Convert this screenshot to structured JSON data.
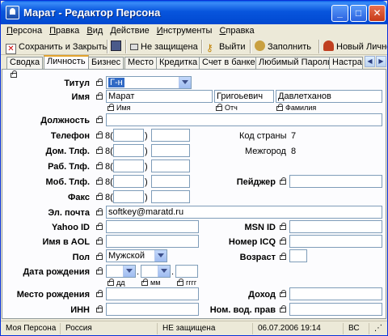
{
  "window": {
    "title": "Марат - Редактор Персона"
  },
  "menu": [
    "Персона",
    "Правка",
    "Вид",
    "Действие",
    "Инструменты",
    "Справка"
  ],
  "toolbar": {
    "save_close": "Сохранить и Закрыть",
    "not_protected": "Не защищена",
    "exit": "Выйти",
    "fill": "Заполнить",
    "new_person": "Новый Личность"
  },
  "tabs": [
    "Сводка",
    "Личность",
    "Бизнес",
    "Место",
    "Кредитка",
    "Счет в банке",
    "Любимый Пароль",
    "Настра"
  ],
  "form": {
    "title_label": "Титул",
    "title_value": "Г-н",
    "name_label": "Имя",
    "first_name": "Марат",
    "patronymic": "Григоьевич",
    "last_name": "Давлетханов",
    "sub_first": "Имя",
    "sub_patronymic": "Отч",
    "sub_last": "Фамилия",
    "position_label": "Должность",
    "phone_label": "Телефон",
    "home_phone_label": "Дом. Тлф.",
    "work_phone_label": "Раб. Тлф.",
    "mobile_phone_label": "Моб. Тлф.",
    "fax_label": "Факс",
    "phone_prefix": "8(",
    "phone_close": ")",
    "country_code_label": "Код страны",
    "country_code_value": "7",
    "intercity_label": "Межгород",
    "intercity_value": "8",
    "pager_label": "Пейджер",
    "email_label": "Эл. почта",
    "email_value": "softkey@maratd.ru",
    "yahoo_label": "Yahoo ID",
    "msn_label": "MSN ID",
    "aol_label": "Имя в AOL",
    "icq_label": "Номер ICQ",
    "gender_label": "Пол",
    "gender_value": "Мужской",
    "age_label": "Возраст",
    "birthdate_label": "Дата рождения",
    "sub_day": "дд",
    "sub_month": "мм",
    "sub_year": "гггг",
    "birthplace_label": "Место рождения",
    "income_label": "Доход",
    "inn_label": "ИНН",
    "license_label": "Ном. вод. прав"
  },
  "status": {
    "person": "Моя Персона",
    "country": "Россия",
    "protection": "НЕ защищена",
    "datetime": "06.07.2006 19:14",
    "mode": "ВС"
  },
  "colors": {
    "titlebar": "#0855dd",
    "tab_accent": "#e3a32d",
    "selection": "#316ac5"
  }
}
